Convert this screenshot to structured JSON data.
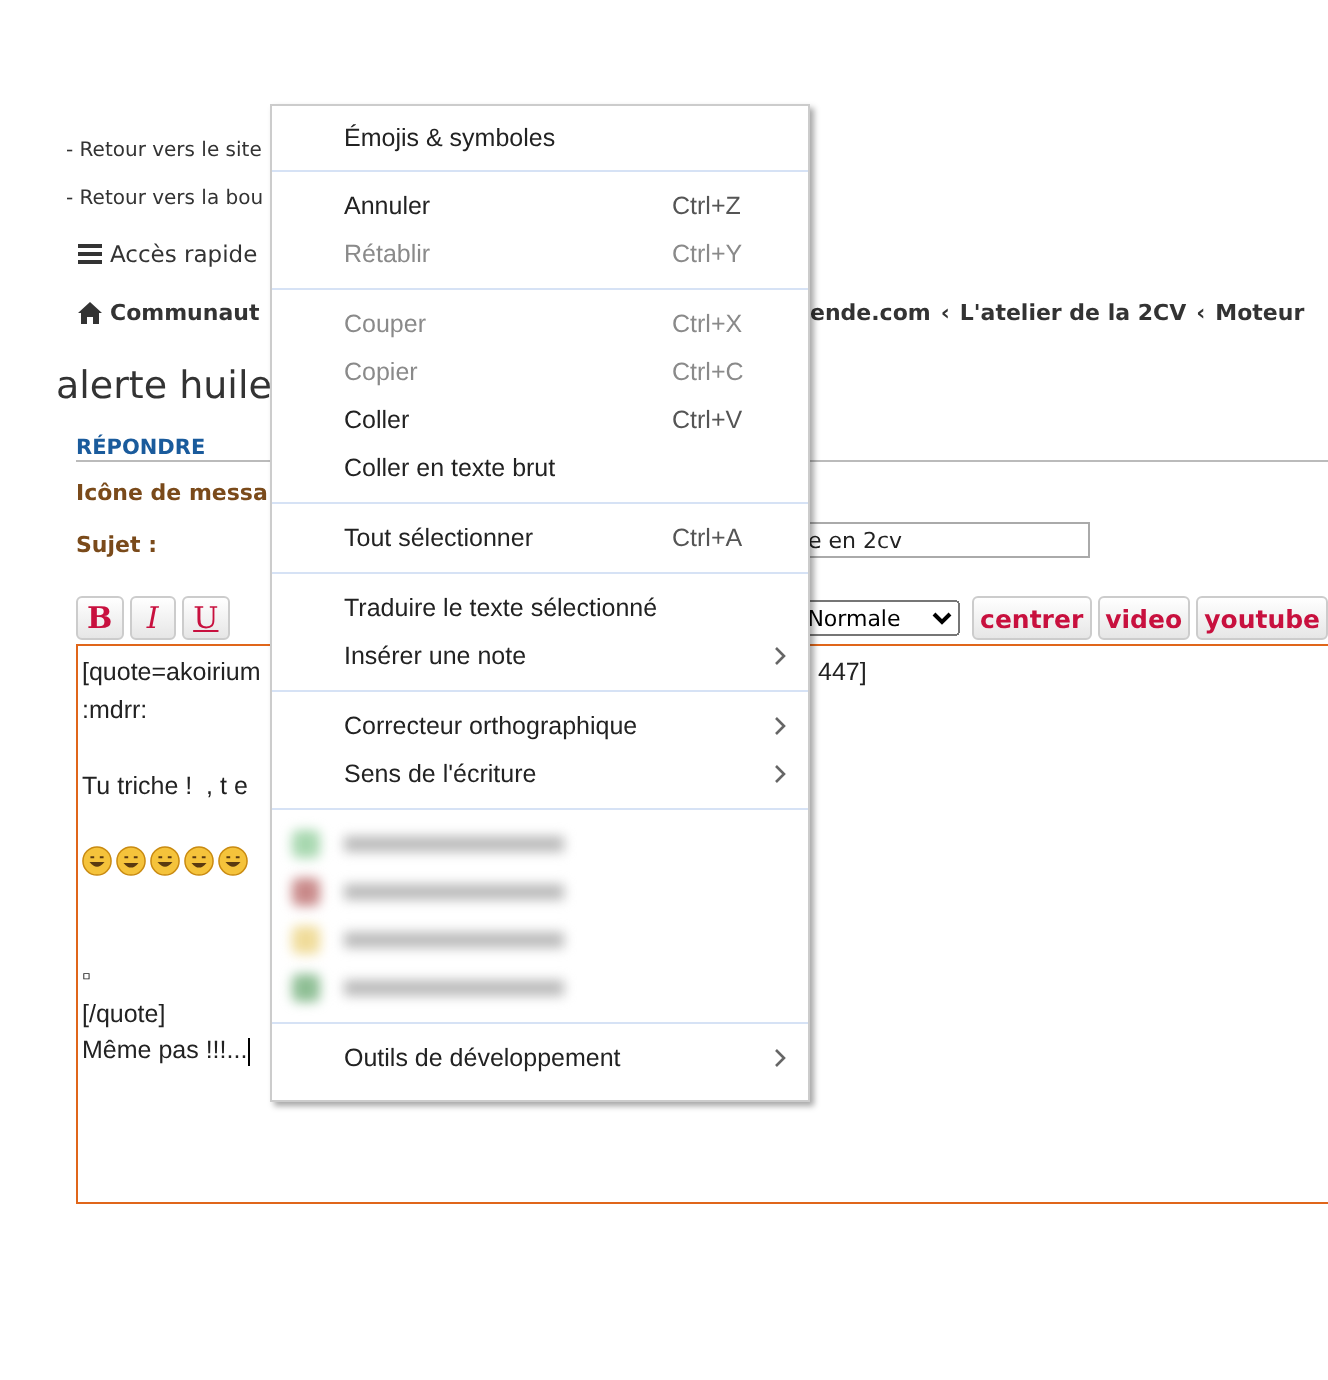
{
  "page": {
    "back_links": [
      "- Retour vers le site",
      "- Retour vers la bou"
    ],
    "quick_access": "Accès rapide",
    "breadcrumb": {
      "first": "Communaut",
      "separator": "‹",
      "rest": [
        "ende.com",
        "L'atelier de la 2CV",
        "Moteur"
      ]
    },
    "title": "alerte huile",
    "reply_tab": "RÉPONDRE",
    "icon_label": "Icône de messa",
    "subject_label": "Sujet :",
    "subject_value": "e en 2cv",
    "format_buttons": [
      {
        "kind": "bold",
        "label": "B"
      },
      {
        "kind": "italic",
        "label": "I"
      },
      {
        "kind": "underline",
        "label": "U"
      }
    ],
    "size_select": "Normale",
    "tag_buttons": [
      "centrer",
      "video",
      "youtube"
    ],
    "editor_lines": [
      {
        "kind": "text",
        "left": "[quote=akoirium",
        "right": "447]"
      },
      {
        "kind": "text",
        "left": ":mdrr:"
      },
      {
        "kind": "blank"
      },
      {
        "kind": "text",
        "left": "Tu triche !  , t e"
      },
      {
        "kind": "blank"
      },
      {
        "kind": "emojis"
      },
      {
        "kind": "blank"
      },
      {
        "kind": "blank"
      },
      {
        "kind": "text",
        "left": "▫"
      },
      {
        "kind": "text",
        "left": "[/quote]"
      },
      {
        "kind": "text",
        "left": "Même pas !!!...",
        "caret": true
      }
    ]
  },
  "context_menu": {
    "groups": [
      [
        {
          "kind": "command",
          "label": "Émojis & symboles",
          "disabled": false,
          "submenu": false
        }
      ],
      [
        {
          "kind": "command",
          "label": "Annuler",
          "shortcut": "Ctrl+Z",
          "disabled": false,
          "submenu": false
        },
        {
          "kind": "command",
          "label": "Rétablir",
          "shortcut": "Ctrl+Y",
          "disabled": true,
          "submenu": false
        }
      ],
      [
        {
          "kind": "command",
          "label": "Couper",
          "shortcut": "Ctrl+X",
          "disabled": true,
          "submenu": false
        },
        {
          "kind": "command",
          "label": "Copier",
          "shortcut": "Ctrl+C",
          "disabled": true,
          "submenu": false
        },
        {
          "kind": "command",
          "label": "Coller",
          "shortcut": "Ctrl+V",
          "disabled": false,
          "submenu": false
        },
        {
          "kind": "command",
          "label": "Coller en texte brut",
          "disabled": false,
          "submenu": false
        }
      ],
      [
        {
          "kind": "command",
          "label": "Tout sélectionner",
          "shortcut": "Ctrl+A",
          "disabled": false,
          "submenu": false
        }
      ],
      [
        {
          "kind": "command",
          "label": "Traduire le texte sélectionné",
          "disabled": false,
          "submenu": false
        },
        {
          "kind": "command",
          "label": "Insérer une note",
          "disabled": false,
          "submenu": true
        }
      ],
      [
        {
          "kind": "command",
          "label": "Correcteur orthographique",
          "disabled": false,
          "submenu": true
        },
        {
          "kind": "command",
          "label": "Sens de l'écriture",
          "disabled": false,
          "submenu": true
        }
      ],
      [
        {
          "kind": "blurred",
          "color": "#a8d8b0"
        },
        {
          "kind": "blurred",
          "color": "#c98a8a"
        },
        {
          "kind": "blurred",
          "color": "#f0dc9a"
        },
        {
          "kind": "blurred",
          "color": "#8fbf95"
        }
      ],
      [
        {
          "kind": "command",
          "label": "Outils de développement",
          "disabled": false,
          "submenu": true
        }
      ]
    ]
  }
}
